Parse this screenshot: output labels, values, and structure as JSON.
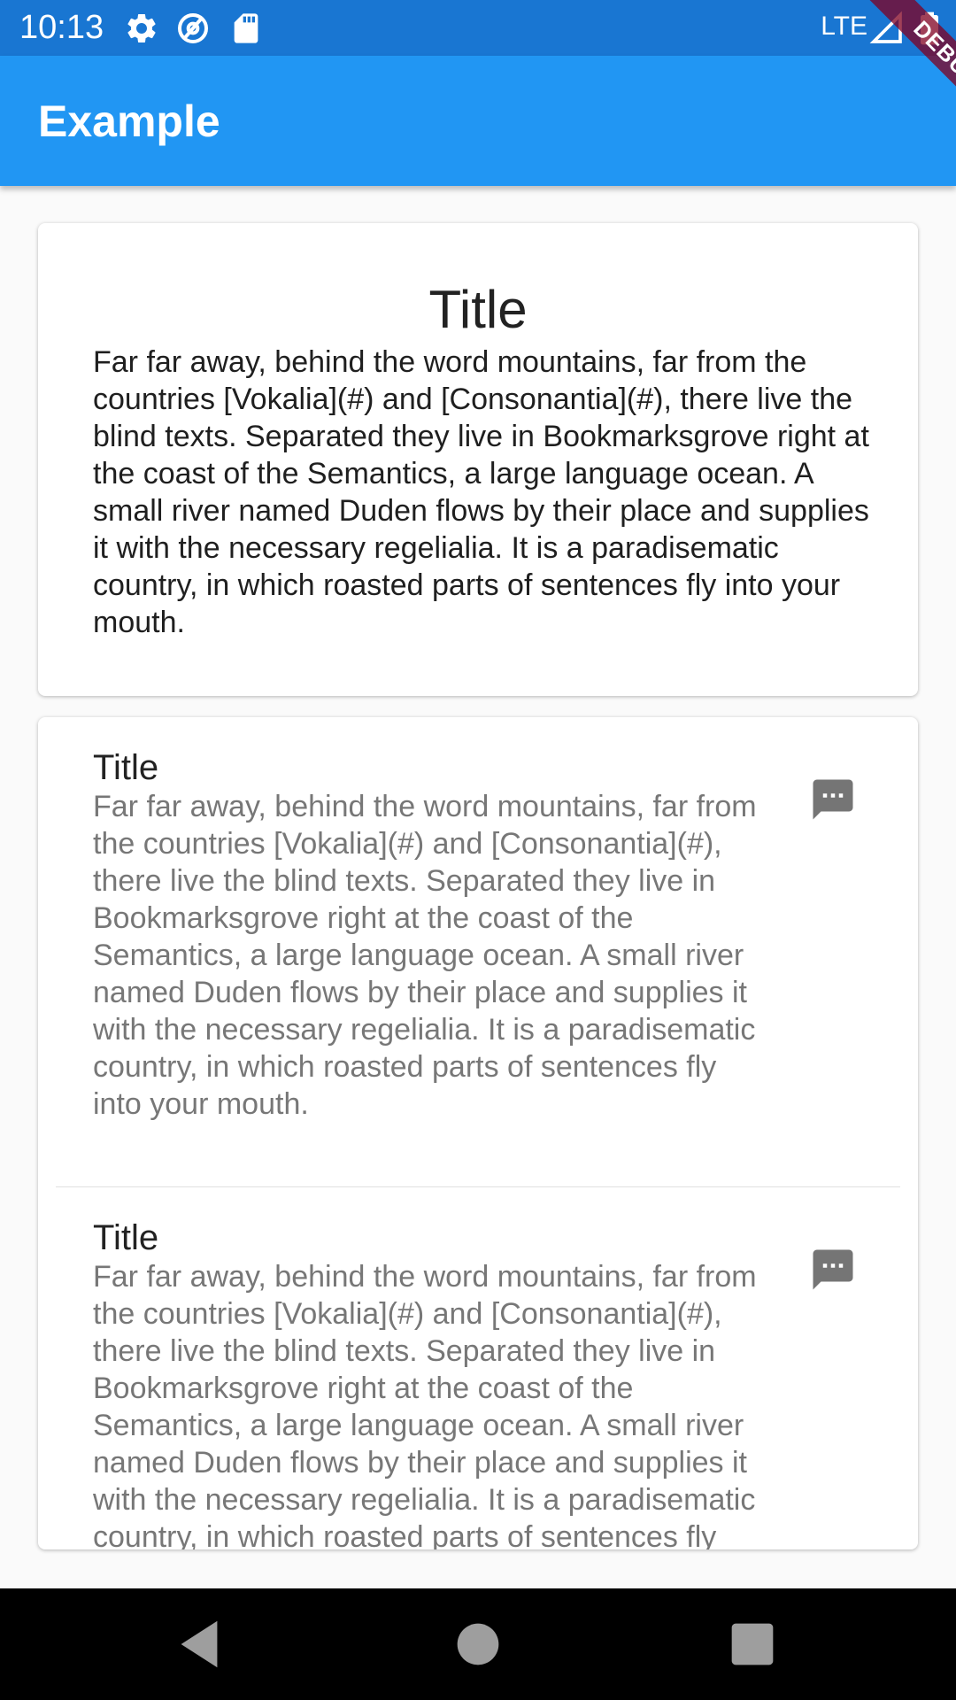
{
  "status_bar": {
    "time": "10:13",
    "network": "LTE",
    "icons": [
      "settings-icon",
      "at-sign-icon",
      "sd-card-icon",
      "signal-icon",
      "battery-icon"
    ]
  },
  "app_bar": {
    "title": "Example",
    "color": "#2196f3"
  },
  "debug_banner": "DEBUG",
  "card1": {
    "title": "Title",
    "body": "Far far away, behind the word mountains, far from the countries [Vokalia](#) and [Consonantia](#), there live the blind texts. Separated they live in Bookmarksgrove right at the coast of the Semantics, a large language ocean. A small river named Duden flows by their place and supplies it with the necessary regelialia. It is a paradisematic country, in which roasted parts of sentences fly into your mouth."
  },
  "list_items": [
    {
      "title": "Title",
      "body": "Far far away, behind the word mountains, far from the countries [Vokalia](#) and [Consonantia](#), there live the blind texts. Separated they live in Bookmarksgrove right at the coast of the Semantics, a large language ocean. A small river named Duden flows by their place and supplies it with the necessary regelialia. It is a paradisematic country, in which roasted parts of sentences fly into your mouth.",
      "icon": "chat-bubble-icon"
    },
    {
      "title": "Title",
      "body": "Far far away, behind the word mountains, far from the countries [Vokalia](#) and [Consonantia](#), there live the blind texts. Separated they live in Bookmarksgrove right at the coast of the Semantics, a large language ocean. A small river named Duden flows by their place and supplies it with the necessary regelialia. It is a paradisematic country, in which roasted parts of sentences fly into your mouth.",
      "icon": "chat-bubble-icon"
    }
  ],
  "nav_bar": {
    "buttons": [
      "back-icon",
      "home-icon",
      "recents-icon"
    ]
  }
}
